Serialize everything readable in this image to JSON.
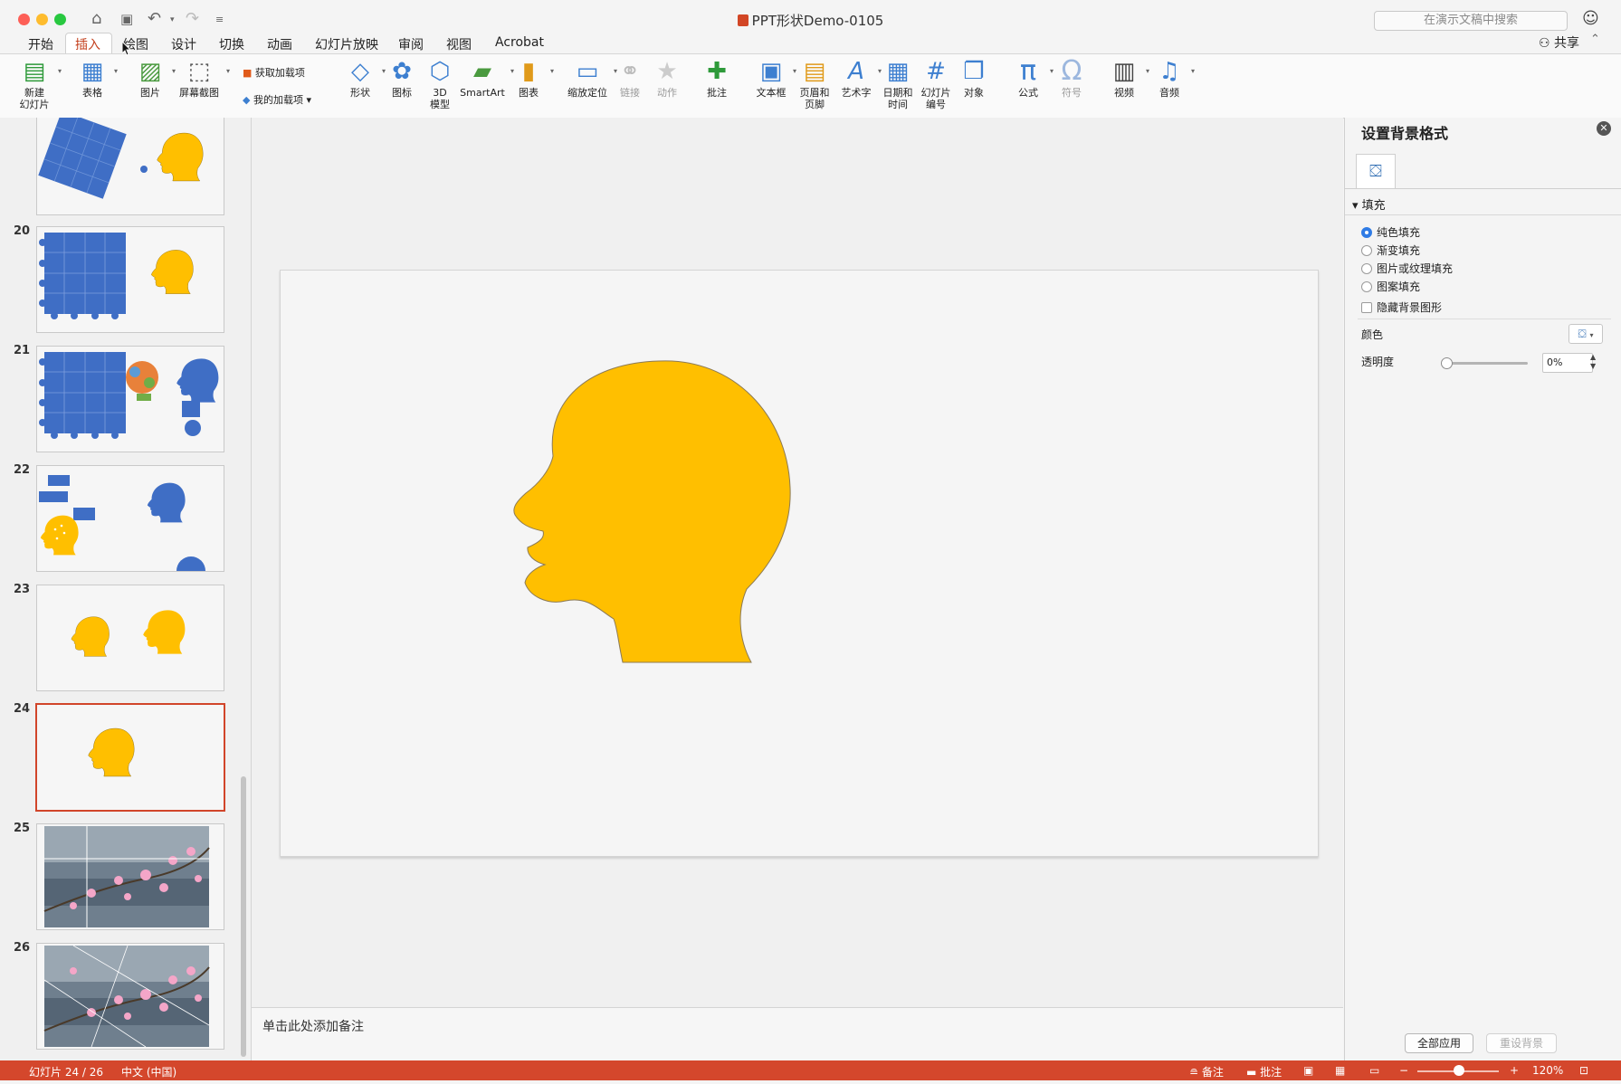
{
  "window": {
    "title": "PPT形状Demo-0105",
    "search_placeholder": "在演示文稿中搜索"
  },
  "tabs": [
    {
      "label": "开始"
    },
    {
      "label": "插入",
      "active": true
    },
    {
      "label": "绘图"
    },
    {
      "label": "设计"
    },
    {
      "label": "切换"
    },
    {
      "label": "动画"
    },
    {
      "label": "幻灯片放映"
    },
    {
      "label": "审阅"
    },
    {
      "label": "视图"
    },
    {
      "label": "Acrobat"
    }
  ],
  "share_label": "共享",
  "ribbon": {
    "new_slide": "新建\n幻灯片",
    "table": "表格",
    "picture": "图片",
    "screenshot": "屏幕截图",
    "get_addins": "获取加载项",
    "my_addins": "我的加载项",
    "shapes": "形状",
    "icons": "图标",
    "model3d": "3D\n模型",
    "smartart": "SmartArt",
    "chart": "图表",
    "zoom": "缩放定位",
    "link": "链接",
    "action": "动作",
    "comment": "批注",
    "textbox": "文本框",
    "header_footer": "页眉和\n页脚",
    "wordart": "艺术字",
    "datetime": "日期和\n时间",
    "slide_number": "幻灯片\n编号",
    "object": "对象",
    "equation": "公式",
    "symbol": "符号",
    "video": "视频",
    "audio": "音频"
  },
  "thumbnails": [
    {
      "num": "",
      "kind": "puzzle-rot"
    },
    {
      "num": "20",
      "kind": "puzzle-head"
    },
    {
      "num": "21",
      "kind": "puzzle-brain"
    },
    {
      "num": "22",
      "kind": "scatter"
    },
    {
      "num": "23",
      "kind": "two-heads"
    },
    {
      "num": "24",
      "kind": "one-head",
      "selected": true
    },
    {
      "num": "25",
      "kind": "photo-grid"
    },
    {
      "num": "26",
      "kind": "photo-lines"
    }
  ],
  "notes_placeholder": "单击此处添加备注",
  "format_pane": {
    "title": "设置背景格式",
    "fill_section": "填充",
    "options": [
      {
        "label": "纯色填充",
        "checked": true
      },
      {
        "label": "渐变填充",
        "checked": false
      },
      {
        "label": "图片或纹理填充",
        "checked": false
      },
      {
        "label": "图案填充",
        "checked": false
      }
    ],
    "hide_bg_graphics": "隐藏背景图形",
    "color_label": "颜色",
    "transparency_label": "透明度",
    "transparency_value": "0%",
    "apply_all": "全部应用",
    "reset_bg": "重设背景"
  },
  "status": {
    "slide_info": "幻灯片 24 / 26",
    "language": "中文 (中国)",
    "notes": "备注",
    "comments": "批注",
    "zoom": "120%"
  },
  "colors": {
    "accent": "#d4472c",
    "head": "#ffbf00",
    "puzzle": "#3f6ec5"
  }
}
